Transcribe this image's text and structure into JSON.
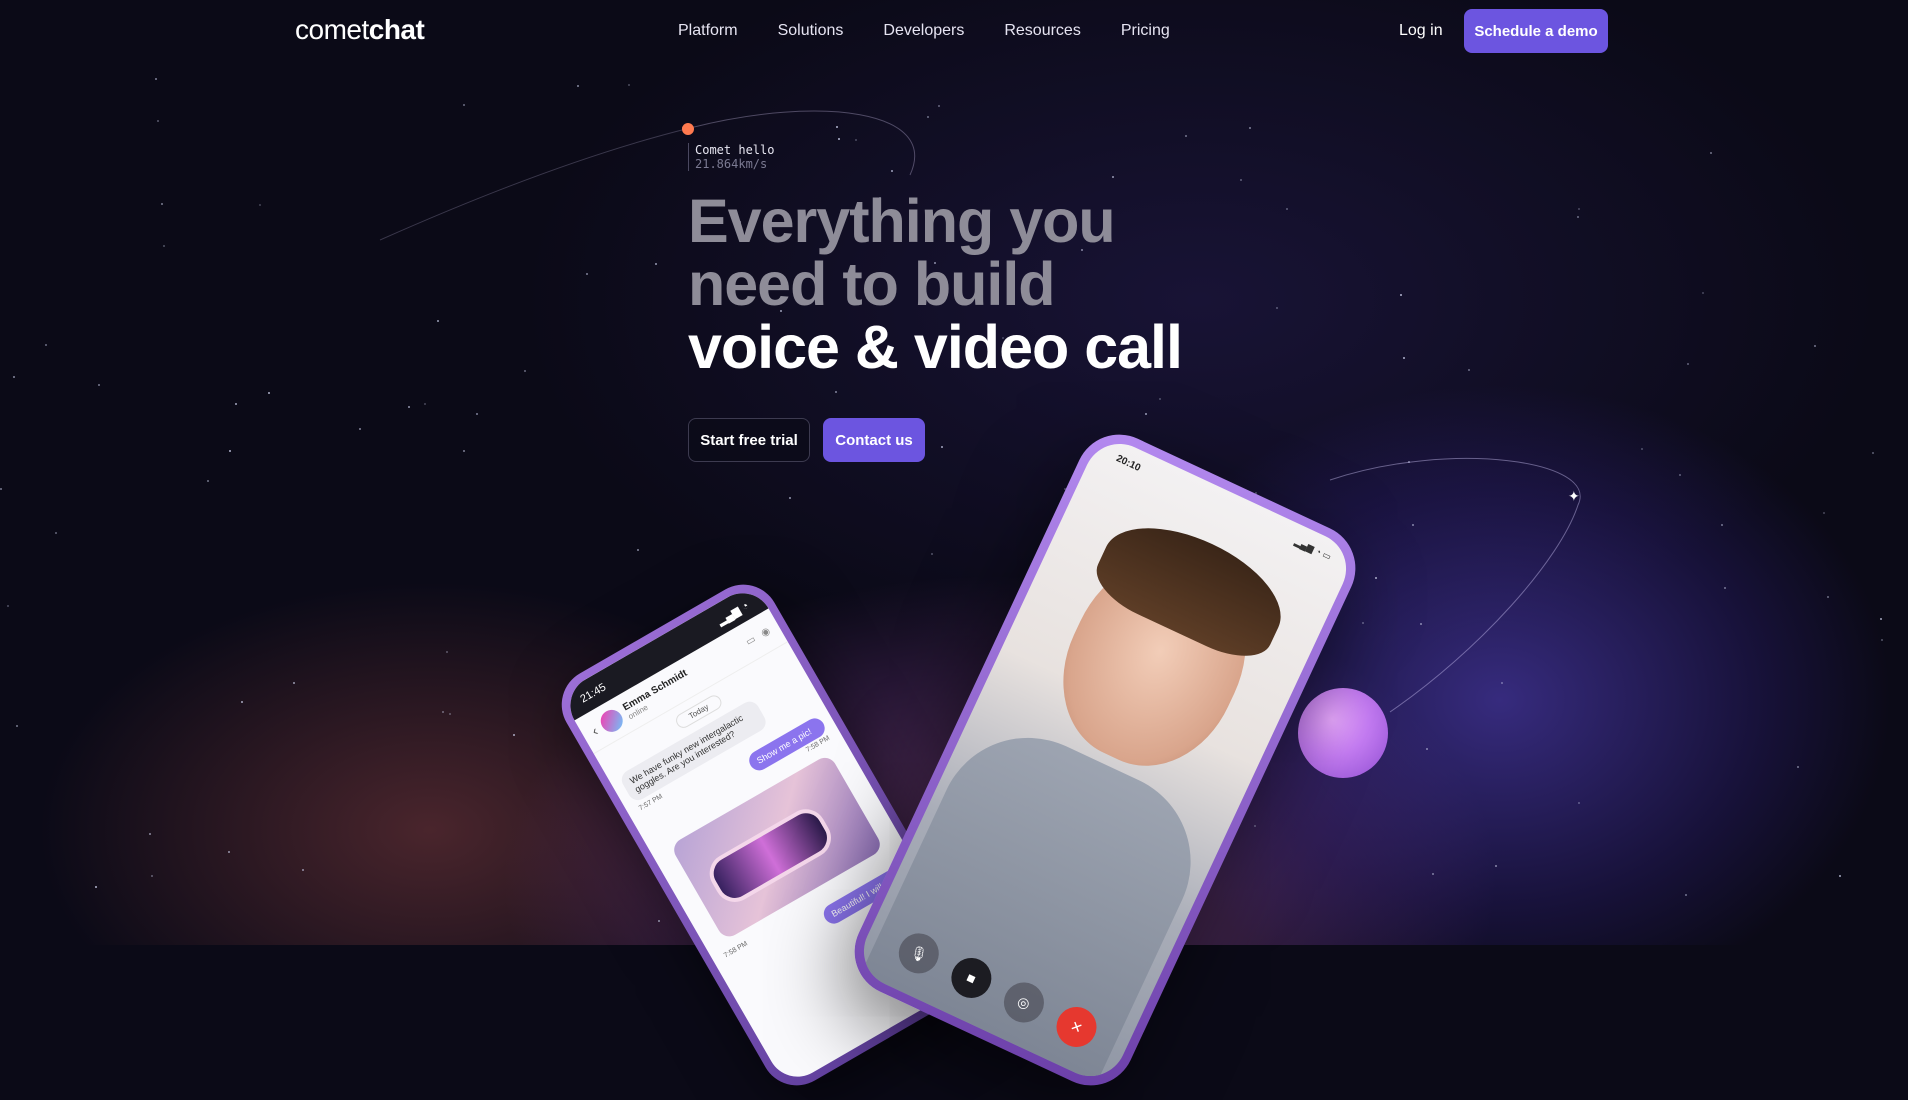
{
  "brand": {
    "logo_light": "comet",
    "logo_bold": "chat"
  },
  "nav": {
    "links": [
      "Platform",
      "Solutions",
      "Developers",
      "Resources",
      "Pricing"
    ],
    "login": "Log in",
    "cta": "Schedule a demo"
  },
  "hero": {
    "comet_name": "Comet hello",
    "comet_speed": "21.864km/s",
    "headline_line1": "Everything you",
    "headline_line2": "need to build",
    "headline_line3": "voice & video call",
    "primary_button": "Start free trial",
    "secondary_button": "Contact us"
  },
  "chat_phone": {
    "clock": "21:45",
    "contact_name": "Emma Schmidt",
    "contact_status": "online",
    "day_label": "Today",
    "msg_in": "We have funky new intergalactic goggles. Are you interested?",
    "msg_in_time": "7:57 PM",
    "msg_out": "Show me a pic!",
    "msg_out_time": "7:58 PM",
    "img_time": "7:58 PM",
    "msg_out2": "Beautiful! I will g"
  },
  "call_phone": {
    "clock": "20:10"
  },
  "colors": {
    "accent": "#6c55e0",
    "background": "#0b0a17",
    "end_call": "#e6382f"
  }
}
